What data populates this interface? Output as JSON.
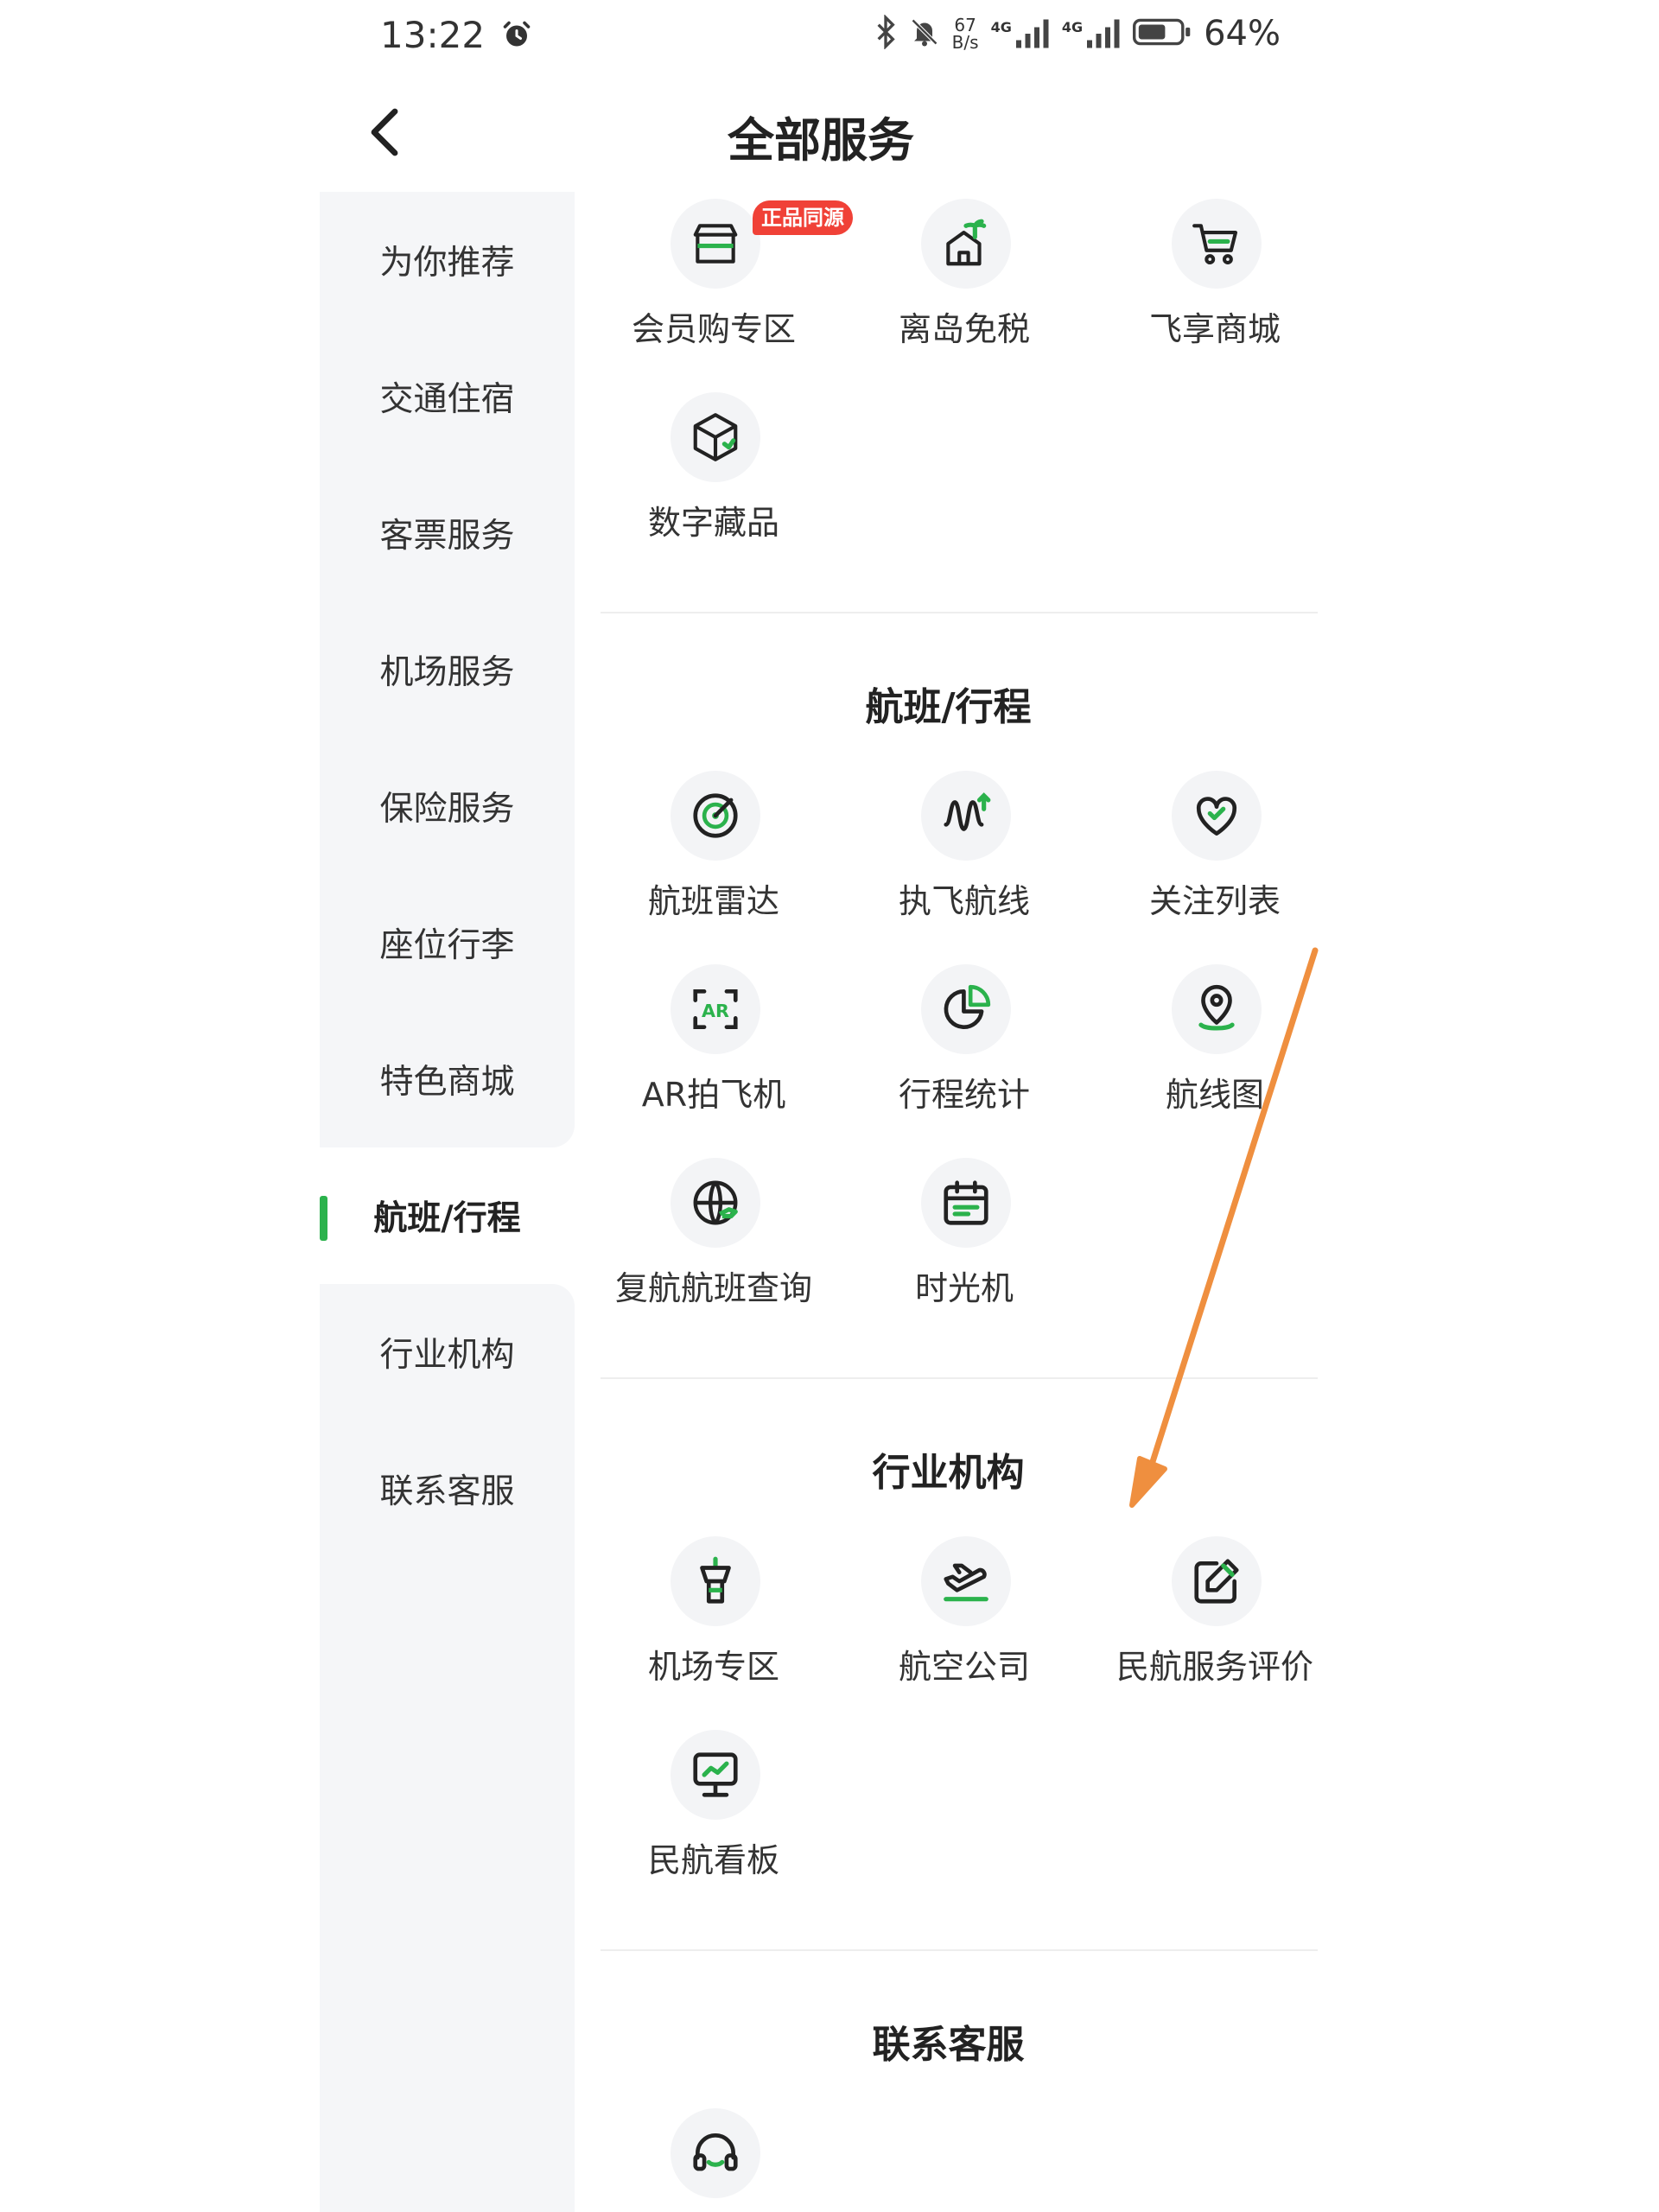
{
  "status_bar": {
    "time": "13:22",
    "net_rate_top": "67",
    "net_rate_bottom": "B/s",
    "net_type_1": "4G",
    "net_type_2": "4G",
    "battery": "64%"
  },
  "header": {
    "title": "全部服务"
  },
  "sidebar": {
    "items": [
      {
        "label": "为你推荐"
      },
      {
        "label": "交通住宿"
      },
      {
        "label": "客票服务"
      },
      {
        "label": "机场服务"
      },
      {
        "label": "保险服务"
      },
      {
        "label": "座位行李"
      },
      {
        "label": "特色商城"
      },
      {
        "label": "航班/行程"
      },
      {
        "label": "行业机构"
      },
      {
        "label": "联系客服"
      }
    ],
    "active_index": 7
  },
  "sections": {
    "shop": {
      "items": [
        {
          "label": "会员购专区",
          "icon": "shop-window-icon",
          "badge": "正品同源"
        },
        {
          "label": "离岛免税",
          "icon": "island-house-icon"
        },
        {
          "label": "飞享商城",
          "icon": "cart-icon"
        },
        {
          "label": "数字藏品",
          "icon": "cube-icon"
        }
      ]
    },
    "flight": {
      "title": "航班/行程",
      "items": [
        {
          "label": "航班雷达",
          "icon": "radar-icon"
        },
        {
          "label": "执飞航线",
          "icon": "route-icon"
        },
        {
          "label": "关注列表",
          "icon": "heart-icon"
        },
        {
          "label": "AR拍飞机",
          "icon": "ar-scan-icon"
        },
        {
          "label": "行程统计",
          "icon": "pie-chart-icon"
        },
        {
          "label": "航线图",
          "icon": "map-pin-icon"
        },
        {
          "label": "复航航班查询",
          "icon": "globe-icon"
        },
        {
          "label": "时光机",
          "icon": "calendar-icon"
        }
      ]
    },
    "industry": {
      "title": "行业机构",
      "items": [
        {
          "label": "机场专区",
          "icon": "control-tower-icon"
        },
        {
          "label": "航空公司",
          "icon": "airplane-icon"
        },
        {
          "label": "民航服务评价",
          "icon": "edit-icon"
        },
        {
          "label": "民航看板",
          "icon": "monitor-chart-icon"
        }
      ]
    },
    "support": {
      "title": "联系客服",
      "items": [
        {
          "icon": "headset-icon"
        }
      ]
    }
  },
  "colors": {
    "accent": "#2bb24c",
    "badge": "#f04137",
    "annotation_arrow": "#ef8f3f",
    "sidebar_bg": "#f5f6f8"
  }
}
